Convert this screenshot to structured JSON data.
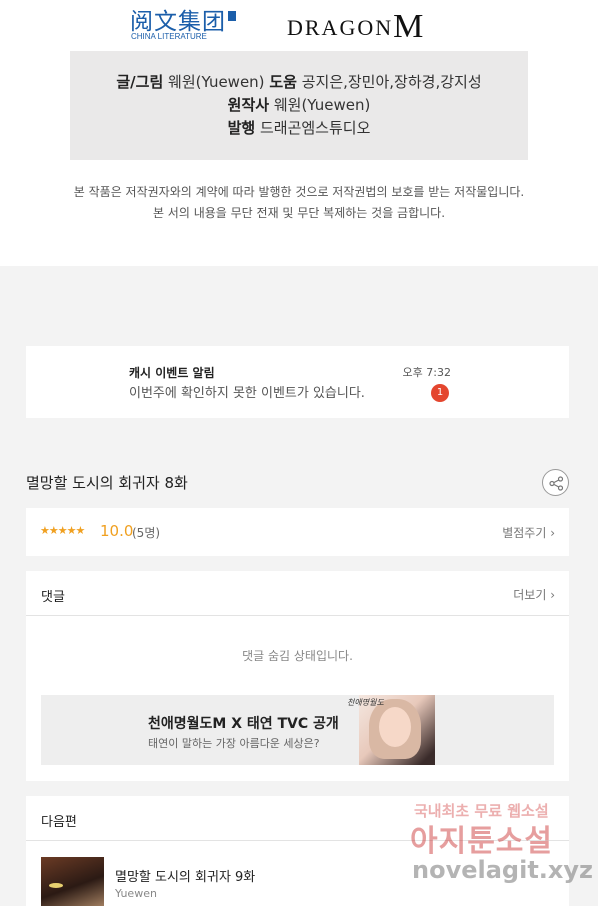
{
  "header": {
    "logo_left_cn": "阅文集团",
    "logo_left_en": "CHINA LITERATURE",
    "logo_right": "DRAGON",
    "logo_right_mark": "M"
  },
  "credits": {
    "writer_key": "글/그림",
    "writer_value": "웨원(Yuewen)",
    "help_key": "도움",
    "help_value": "공지은,장민아,장하경,강지성",
    "original_key": "원작사",
    "original_value": "웨원(Yuewen)",
    "publisher_key": "발행",
    "publisher_value": "드래곤엠스튜디오"
  },
  "notice": {
    "line1": "본 작품은 저작권자와의 계약에 따라 발행한 것으로 저작권법의 보호를 받는 저작물입니다.",
    "line2": "본 서의 내용을 무단 전재 및 무단 복제하는 것을 금합니다."
  },
  "event": {
    "title": "캐시 이벤트 알림",
    "message": "이번주에 확인하지 못한 이벤트가 있습니다.",
    "time": "오후 7:32",
    "badge_count": "1",
    "badge_color": "#e4462f"
  },
  "episode": {
    "title": "멸망할 도시의 회귀자 8화",
    "share_icon": "share-icon"
  },
  "rating": {
    "stars": "★★★★★",
    "score": "10.0",
    "count": "(5명)",
    "rate_button": "별점주기 ›",
    "accent_color": "#f0a020"
  },
  "comments": {
    "label": "댓글",
    "more": "더보기 ›",
    "hidden_message": "댓글 숨김 상태입니다."
  },
  "banner": {
    "title": "천애명월도M X 태연 TVC 공개",
    "subtitle": "태연이 말하는 가장 아름다운 세상은?",
    "signature": "천애명월도"
  },
  "next": {
    "label": "다음편",
    "episode_title": "멸망할 도시의 회귀자 9화",
    "author": "Yuewen"
  },
  "watermark": {
    "line1": "국내최초 무료 웹소설",
    "line2": "아지툰소설",
    "line3": "novelagit.xyz"
  }
}
